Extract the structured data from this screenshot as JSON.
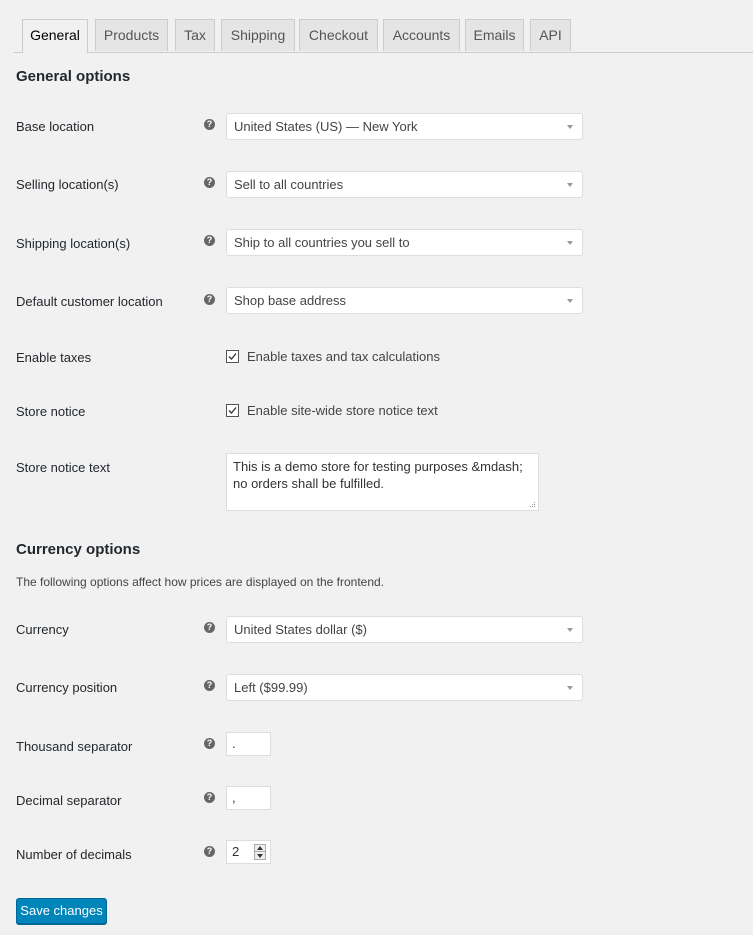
{
  "tabs": [
    {
      "label": "General",
      "active": true
    },
    {
      "label": "Products"
    },
    {
      "label": "Tax"
    },
    {
      "label": "Shipping"
    },
    {
      "label": "Checkout"
    },
    {
      "label": "Accounts"
    },
    {
      "label": "Emails"
    },
    {
      "label": "API"
    }
  ],
  "general": {
    "heading": "General options",
    "base_location": {
      "label": "Base location",
      "value": "United States (US) — New York"
    },
    "selling_locations": {
      "label": "Selling location(s)",
      "value": "Sell to all countries"
    },
    "shipping_locations": {
      "label": "Shipping location(s)",
      "value": "Ship to all countries you sell to"
    },
    "default_customer_location": {
      "label": "Default customer location",
      "value": "Shop base address"
    },
    "enable_taxes": {
      "label": "Enable taxes",
      "checkbox_label": "Enable taxes and tax calculations",
      "checked": true
    },
    "store_notice": {
      "label": "Store notice",
      "checkbox_label": "Enable site-wide store notice text",
      "checked": true
    },
    "store_notice_text": {
      "label": "Store notice text",
      "value": "This is a demo store for testing purposes &mdash; no orders shall be fulfilled."
    }
  },
  "currency": {
    "heading": "Currency options",
    "description": "The following options affect how prices are displayed on the frontend.",
    "currency": {
      "label": "Currency",
      "value": "United States dollar ($)"
    },
    "currency_position": {
      "label": "Currency position",
      "value": "Left ($99.99)"
    },
    "thousand_separator": {
      "label": "Thousand separator",
      "value": "."
    },
    "decimal_separator": {
      "label": "Decimal separator",
      "value": ","
    },
    "number_of_decimals": {
      "label": "Number of decimals",
      "value": "2"
    }
  },
  "help_glyph": "?",
  "save_label": "Save changes",
  "colors": {
    "primary_button": "#0085ba",
    "background": "#f1f1f1"
  }
}
